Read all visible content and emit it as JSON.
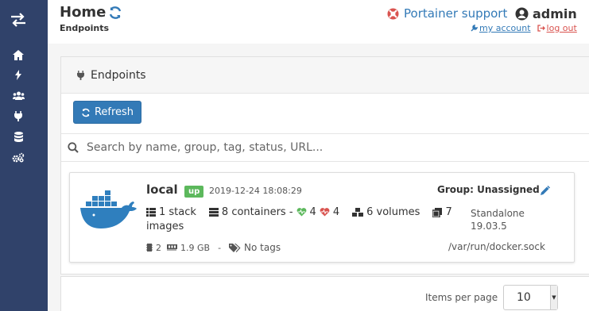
{
  "header": {
    "title": "Home",
    "subtitle": "Endpoints",
    "support_label": "Portainer support",
    "username": "admin",
    "my_account_label": "my account",
    "logout_label": "log out"
  },
  "sidebar": {
    "items": [
      {
        "icon": "home-icon"
      },
      {
        "icon": "bolt-icon"
      },
      {
        "icon": "users-icon"
      },
      {
        "icon": "plug-icon"
      },
      {
        "icon": "database-icon"
      },
      {
        "icon": "cogs-icon"
      }
    ]
  },
  "panel": {
    "title": "Endpoints",
    "refresh_label": "Refresh",
    "search_placeholder": "Search by name, group, tag, status, URL..."
  },
  "endpoint": {
    "name": "local",
    "status": "up",
    "date": "2019-12-24 18:08:29",
    "group": "Group: Unassigned",
    "stacks": "1 stack",
    "containers": "8 containers -",
    "healthy": "4",
    "unhealthy": "4",
    "volumes": "6 volumes",
    "images_count": "7",
    "images_label": "images",
    "engine": "Standalone",
    "version": "19.03.5",
    "cpus": "2",
    "memory": "1.9 GB",
    "separator": "-",
    "tags": "No tags",
    "url": "/var/run/docker.sock"
  },
  "pagination": {
    "label": "Items per page",
    "value": "10"
  },
  "colors": {
    "sidebar": "#30426a",
    "primary": "#337ab7",
    "success": "#5cb85c",
    "danger": "#d9534f",
    "docker": "#2f7fbe"
  }
}
